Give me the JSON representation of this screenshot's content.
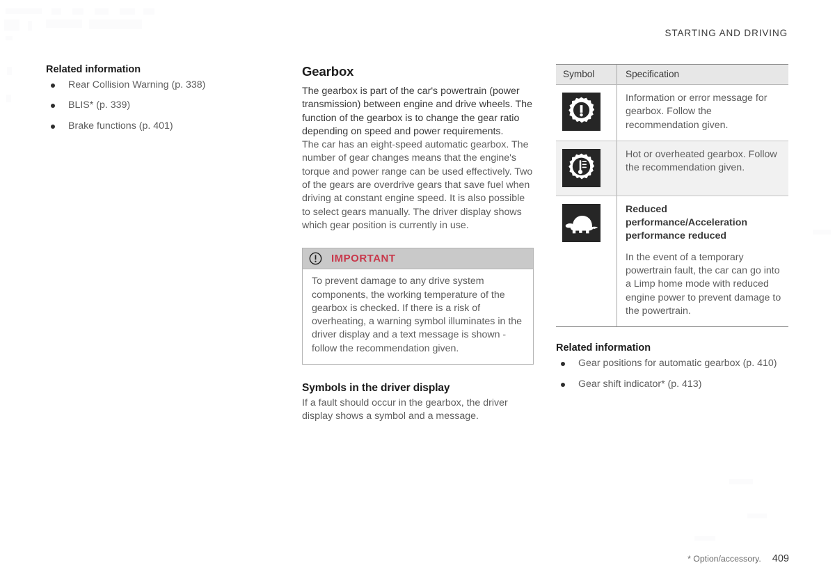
{
  "header": {
    "running_title": "STARTING AND DRIVING"
  },
  "left_column": {
    "related_title": "Related information",
    "related_links": [
      "Rear Collision Warning (p. 338)",
      "BLIS* (p. 339)",
      "Brake functions (p. 401)"
    ]
  },
  "middle_column": {
    "section_title": "Gearbox",
    "lead_paragraph": "The gearbox is part of the car's powertrain (power transmission) between engine and drive wheels. The function of the gearbox is to change the gear ratio depending on speed and power requirements.",
    "second_paragraph": "The car has an eight-speed automatic gearbox. The number of gear changes means that the engine's torque and power range can be used effectively. Two of the gears are overdrive gears that save fuel when driving at constant engine speed. It is also possible to select gears manually. The driver display shows which gear position is currently in use.",
    "callout": {
      "icon": "exclamation-circle-icon",
      "label": "IMPORTANT",
      "accent_color": "#c8384b",
      "header_background": "#c9c9c9",
      "text": "To prevent damage to any drive system components, the working temperature of the gearbox is checked. If there is a risk of overheating, a warning symbol illuminates in the driver display and a text message is shown - follow the recommendation given."
    },
    "subsection_title": "Symbols in the driver display",
    "subsection_text": "If a fault should occur in the gearbox, the driver display shows a symbol and a message."
  },
  "right_column": {
    "table": {
      "columns": [
        "Symbol",
        "Specification"
      ],
      "rows": [
        {
          "icon": "gear-exclamation-icon",
          "shaded": false,
          "heading": "",
          "text": "Information or error message for gearbox. Follow the recommendation given."
        },
        {
          "icon": "gear-thermometer-icon",
          "shaded": true,
          "heading": "",
          "text": "Hot or overheated gearbox. Follow the recommendation given."
        },
        {
          "icon": "turtle-icon",
          "shaded": false,
          "heading": "Reduced performance/Acceleration performance reduced",
          "text": "In the event of a temporary powertrain fault, the car can go into a Limp home mode with reduced engine power to prevent damage to the powertrain."
        }
      ]
    },
    "related_title": "Related information",
    "related_links": [
      "Gear positions for automatic gearbox (p. 410)",
      "Gear shift indicator* (p. 413)"
    ]
  },
  "footer": {
    "note": "* Option/accessory.",
    "page_number": "409"
  }
}
